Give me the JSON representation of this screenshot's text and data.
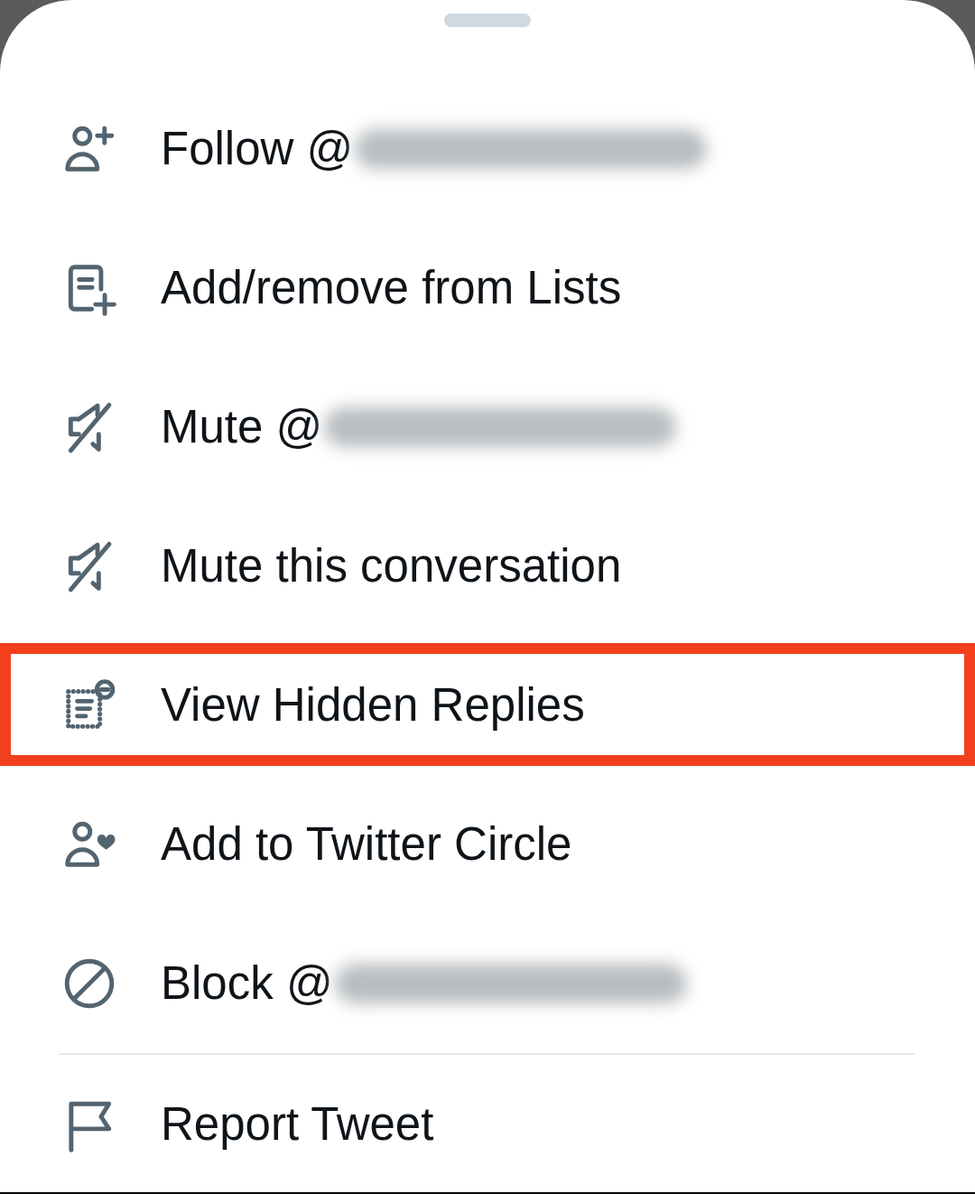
{
  "sheet": {
    "sections": [
      {
        "items": [
          {
            "kind": "follow",
            "label": "Follow @",
            "redacted": true,
            "highlighted": false
          },
          {
            "kind": "lists",
            "label": "Add/remove from Lists",
            "redacted": false,
            "highlighted": false
          },
          {
            "kind": "mute",
            "label": "Mute @",
            "redacted": true,
            "highlighted": false
          },
          {
            "kind": "mute",
            "label": "Mute this conversation",
            "redacted": false,
            "highlighted": false
          },
          {
            "kind": "hidden",
            "label": "View Hidden Replies",
            "redacted": false,
            "highlighted": true
          },
          {
            "kind": "circle",
            "label": "Add to Twitter Circle",
            "redacted": false,
            "highlighted": false
          },
          {
            "kind": "block",
            "label": "Block @",
            "redacted": true,
            "highlighted": false
          }
        ]
      },
      {
        "items": [
          {
            "kind": "report",
            "label": "Report Tweet",
            "redacted": false,
            "highlighted": false
          }
        ]
      }
    ]
  }
}
